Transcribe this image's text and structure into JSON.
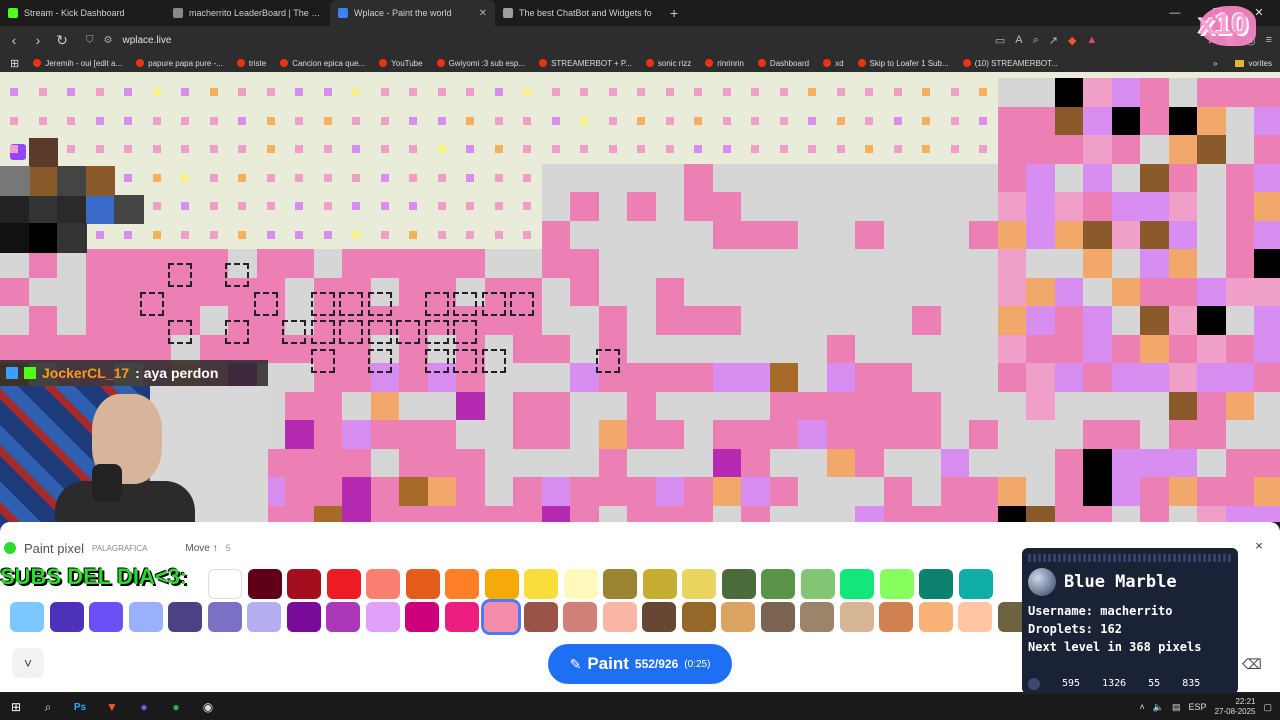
{
  "tabs": [
    {
      "title": "Stream - Kick Dashboard",
      "icon": "kick-icon",
      "color": "#53fc18",
      "active": false
    },
    {
      "title": "macherrito LeaderBoard | The best C",
      "icon": "page-icon",
      "color": "#888888",
      "active": false
    },
    {
      "title": "Wplace - Paint the world",
      "icon": "speaker-icon",
      "color": "#3b82f6",
      "active": true
    },
    {
      "title": "The best ChatBot and Widgets fo",
      "icon": "speaker-icon",
      "color": "#9aa0a6",
      "active": false
    }
  ],
  "browser": {
    "url": "wplace.live",
    "new_tab": "+"
  },
  "bookmarks": [
    "Jeremih - oui [edit a...",
    "papure papa pure -...",
    "triste",
    "Cancion epica que...",
    "YouTube",
    "Gwiyomi :3 sub esp...",
    "STREAMERBOT + P...",
    "sonic rizz",
    "rinrinrin",
    "Dashboard",
    "xd",
    "Skip to Loafer 1 Sub...",
    "(10) STREAMERBOT..."
  ],
  "bookmarks_more": "vorites",
  "overlay": {
    "chat_name": "JockerCL_17",
    "chat_msg": ": aya perdon",
    "subs_text": "SUBS DEL DIA<3:",
    "x10": "x10",
    "cam_label": "PALAGRAFICA"
  },
  "wplace": {
    "paint_pixel_label": "Paint pixel",
    "move_label": "Move ↑",
    "move_count": "5",
    "paint_button": "Paint",
    "paint_count": "552/926",
    "paint_timer": "(0:25)",
    "close": "×",
    "collapse": "˅",
    "palette_row1": [
      "#ffffff",
      "#600018",
      "#a50e1e",
      "#ed1c24",
      "#fa8072",
      "#e45c1a",
      "#ff7f27",
      "#f6aa09",
      "#f9dd3b",
      "#fffabc",
      "#9c8431",
      "#c5ad31",
      "#e8d45f",
      "#4a6b3a",
      "#5a944a",
      "#84c573",
      "#13e67b",
      "#87ff5e",
      "#0c816e",
      "#10aea6"
    ],
    "palette_row2": [
      "#7dc7ff",
      "#4d31b8",
      "#6b50f6",
      "#99b1fb",
      "#4a4284",
      "#7a71c4",
      "#b5aef1",
      "#780c99",
      "#aa38b9",
      "#e09ff9",
      "#cb007a",
      "#ec1f80",
      "#f38da9",
      "#9b5249",
      "#d18078",
      "#fab6a4",
      "#684634",
      "#95682a",
      "#dba463",
      "#7b6352",
      "#9c846b",
      "#d6b594",
      "#d18051",
      "#f8b277",
      "#ffc5a5",
      "#6d643f"
    ]
  },
  "blue_marble": {
    "title": "Blue Marble",
    "username_label": "Username: ",
    "username": "macherrito",
    "droplets_label": "Droplets: ",
    "droplets": "162",
    "next_level_prefix": "Next level in ",
    "next_level_value": "368",
    "next_level_suffix": " pixels",
    "coords": [
      "595",
      "1326",
      "55",
      "835"
    ]
  },
  "taskbar": {
    "lang": "ESP",
    "time": "22:21",
    "date": "27-08-2025"
  }
}
